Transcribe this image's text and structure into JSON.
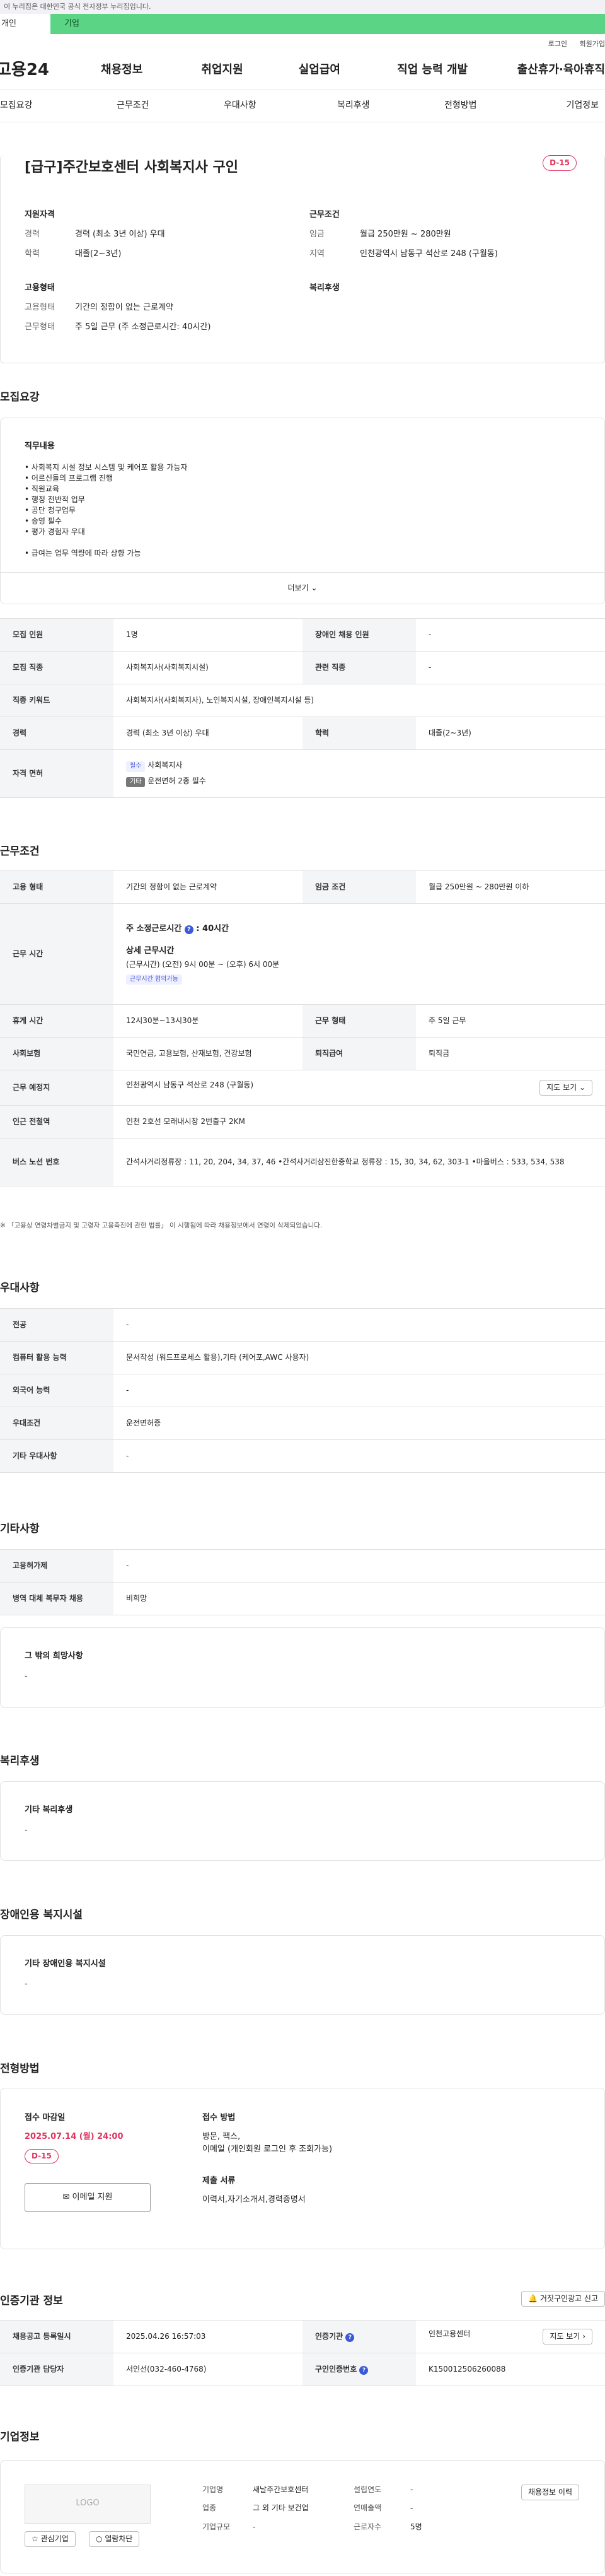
{
  "gov_banner": "이 누리집은 대한민국 공식 전자정부 누리집입니다.",
  "user_tabs": [
    "개인",
    "기업"
  ],
  "util": [
    "로그인",
    "회원가입"
  ],
  "gnb": {
    "logo": "고용24",
    "items": [
      "채용정보",
      "취업지원",
      "실업급여",
      "직업 능력 개발",
      "출산휴가·육아휴직"
    ]
  },
  "subnav": [
    "모집요강",
    "근무조건",
    "우대사항",
    "복리후생",
    "전형방법",
    "기업정보"
  ],
  "job": {
    "title": "[급구]주간보호센터 사회복지사 구인",
    "dday": "D-15",
    "qual": {
      "head": "지원자격",
      "rows": [
        [
          "경력",
          "경력 (최소 3년 이상) 우대"
        ],
        [
          "학력",
          "대졸(2~3년)"
        ]
      ]
    },
    "cond": {
      "head": "근무조건",
      "rows": [
        [
          "임금",
          "월급 250만원 ~ 280만원"
        ],
        [
          "지역",
          "인천광역시 남동구 석산로 248 (구월동)"
        ]
      ]
    },
    "emp": {
      "head": "고용형태",
      "rows": [
        [
          "고용형태",
          "기간의 정함이 없는 근로계약"
        ],
        [
          "근무형태",
          "주 5일 근무 (주 소정근로시간: 40시간)"
        ]
      ]
    },
    "welfare": {
      "head": "복리후생"
    }
  },
  "recruit": {
    "title": "모집요강",
    "duty_head": "직무내용",
    "duties": [
      "• 사회복지 시설 정보 시스템 및 케어포 활용 가능자",
      "• 어르신들의 프로그램 진행",
      "• 직원교육",
      "• 행정 전반적 업무",
      "• 공단 청구업무",
      "• 송영 필수",
      "• 평가 경험자 우대",
      "",
      "• 급여는 업무 역량에 따라 상향 가능"
    ],
    "more": "더보기",
    "rows": [
      [
        "모집 인원",
        "1명",
        "장애인 채용 인원",
        "-"
      ],
      [
        "모집 직종",
        "사회복지사(사회복지시설)",
        "관련 직종",
        "-"
      ],
      [
        "직종 키워드",
        "사회복지사(사회복지사), 노인복지시설, 장애인복지시설 등)"
      ],
      [
        "경력",
        "경력 (최소 3년 이상) 우대",
        "학력",
        "대졸(2~3년)"
      ]
    ],
    "license_label": "자격 면허",
    "license_tag1": "필수",
    "license1": "사회복지사",
    "license_tag2": "기타",
    "license2": "운전면허 2종 필수"
  },
  "work": {
    "title": "근무조건",
    "r1": [
      "고용 형태",
      "기간의 정함이 없는 근로계약",
      "임금 조건",
      "월급 250만원 ~ 280만원 이하"
    ],
    "hours_label": "근무 시간",
    "hours_main": "주 소정근로시간",
    "hours_val": "40시간",
    "detail_head": "상세 근무시간",
    "detail": "(근무시간) (오전) 9시 00분 ~ (오후) 6시 00분",
    "flex_tag": "근무시간 협의가능",
    "rows": [
      [
        "휴게 시간",
        "12시30분~13시30분",
        "근무 형태",
        "주 5일 근무"
      ],
      [
        "사회보험",
        "국민연금, 고용보험, 산재보험, 건강보험",
        "퇴직급여",
        "퇴직금"
      ]
    ],
    "place": [
      "근무 예정지",
      "인천광역시 남동구 석산로 248 (구월동)"
    ],
    "map_btn": "지도 보기",
    "station": [
      "인근 전철역",
      "인천 2호선 모래내시장 2번출구 2KM"
    ],
    "bus": [
      "버스 노선 번호",
      "간석사거리정류장 : 11, 20, 204, 34, 37, 46 •간석사거리삼진한중학교 정류장 : 15, 30, 34, 62, 303-1 •마을버스 : 533, 534, 538"
    ],
    "note": "※ 「고용상 연령차별금지 및 고령자 고용촉진에 관한 법률」 이 시행됨에 따라 채용정보에서 연령이 삭제되었습니다."
  },
  "pref": {
    "title": "우대사항",
    "rows": [
      [
        "전공",
        "-"
      ],
      [
        "컴퓨터 활용 능력",
        "문서작성 (워드프로세스 활용),기타 (케어포,AWC 사용자)"
      ],
      [
        "외국어 능력",
        "-"
      ],
      [
        "우대조건",
        "운전면허증"
      ],
      [
        "기타 우대사항",
        "-"
      ]
    ]
  },
  "etc": {
    "title": "기타사항",
    "rows": [
      [
        "고용허가제",
        "-"
      ],
      [
        "병역 대체 복무자 채용",
        "비희망"
      ]
    ],
    "other_head": "그 밖의 희망사항",
    "other_val": "-"
  },
  "benefit": {
    "title": "복리후생",
    "head": "기타 복리후생",
    "val": "-"
  },
  "disab": {
    "title": "장애인용 복지시설",
    "head": "기타 장애인용 복지시설",
    "val": "-"
  },
  "process": {
    "title": "전형방법",
    "deadline_head": "접수 마감일",
    "deadline": "2025.07.14 (월) 24:00",
    "dday": "D-15",
    "apply_btn": "이메일 지원",
    "method_head": "접수 방법",
    "method1": "방문, 팩스,",
    "method2": "이메일 (개인회원 로그인 후 조회가능)",
    "docs_head": "제출 서류",
    "docs": "이력서,자기소개서,경력증명서"
  },
  "agency": {
    "title": "인증기관 정보",
    "report_btn": "거짓구인광고 신고",
    "rows": [
      [
        "채용공고 등록일시",
        "2025.04.26 16:57:03",
        "인증기관",
        "인천고용센터"
      ],
      [
        "인증기관 담당자",
        "서인선(032-460-4768)",
        "구인인증번호",
        "K150012506260088"
      ]
    ],
    "map_btn": "지도 보기"
  },
  "company": {
    "title": "기업정보",
    "logo": "LOGO",
    "fav_btn": "관심기업",
    "block_btn": "열람차단",
    "rows": [
      [
        "기업명",
        "새날주간보호센터",
        "설립연도",
        "-"
      ],
      [
        "업종",
        "그 외 기타 보건업",
        "연매출액",
        "-"
      ],
      [
        "기업규모",
        "-",
        "근로자수",
        "5명"
      ]
    ],
    "jobs_btn": "채용정보 이력"
  }
}
